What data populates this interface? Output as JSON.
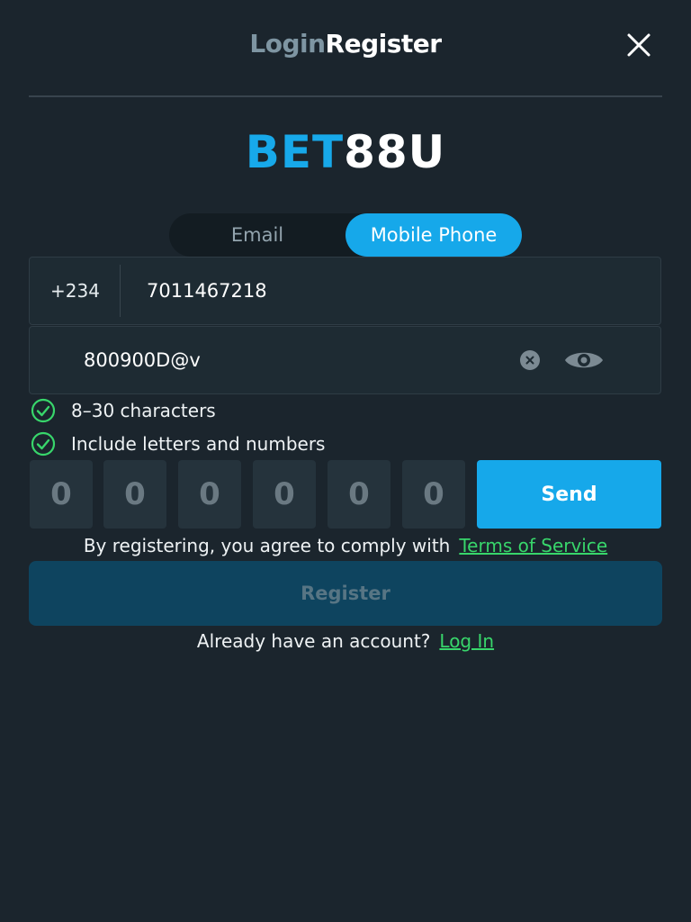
{
  "header": {
    "tab_login": "Login",
    "tab_register": "Register",
    "close_icon": "close-icon"
  },
  "logo": {
    "part1": "BET",
    "part2": "88U",
    "color_part1": "#17a9ea",
    "color_part2": "#ffffff"
  },
  "method_toggle": {
    "email_label": "Email",
    "phone_label": "Mobile Phone",
    "selected": "Mobile Phone"
  },
  "phone_field": {
    "country_code": "+234",
    "value": "7011467218"
  },
  "password_field": {
    "value": "800900D@v",
    "clear_icon": "clear-icon",
    "visibility_icon": "eye-icon"
  },
  "password_rules": [
    {
      "text": "8–30 characters",
      "icon": "check-circle-icon",
      "satisfied": true
    },
    {
      "text": "Include letters and numbers",
      "icon": "check-circle-icon",
      "satisfied": true
    }
  ],
  "verification": {
    "digits": [
      "0",
      "0",
      "0",
      "0",
      "0",
      "0"
    ],
    "send_label": "Send"
  },
  "terms": {
    "text": "By registering, you agree to comply with",
    "link": "Terms of Service"
  },
  "register_label": "Register",
  "login_prompt": {
    "text": "Already have an account?",
    "link": "Log In"
  },
  "colors": {
    "background": "#1b252d",
    "accent_blue": "#16a8ea",
    "link_green": "#38d66b",
    "register_disabled": "#0e445f"
  }
}
